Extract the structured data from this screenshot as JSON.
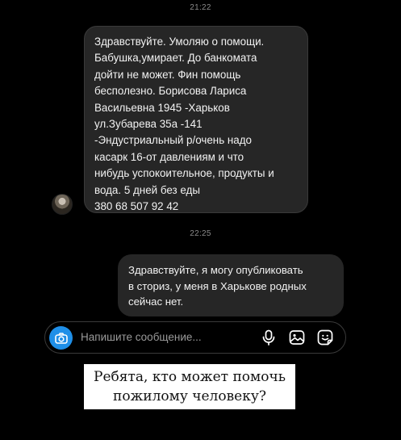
{
  "timestamps": [
    "21:22",
    "22:25"
  ],
  "incoming_message": {
    "lines": [
      "Здравствуйте. Умоляю о помощи.",
      "Бабушка,умирает. До банкомата",
      "дойти не может. Фин помощь",
      "бесполезно. Борисова Лариса",
      "Васильевна 1945 -Харьков",
      "ул.Зубарева 35а -141",
      "-Эндустриальный р/очень надо",
      "касарк 16-от давлениям и что",
      "нибудь успокоительное, продукты и",
      "вода. 5 дней без еды",
      "380 68 507 92 42"
    ]
  },
  "outgoing_message": {
    "lines": [
      "Здравствуйте, я могу опубликовать",
      "в сториз, у меня в Харькове родных",
      "сейчас нет."
    ]
  },
  "composer": {
    "placeholder": "Напишите сообщение...",
    "icons": [
      "camera-icon",
      "microphone-icon",
      "gallery-icon",
      "sticker-icon"
    ],
    "camera_color": "#1f8fe8"
  },
  "banner": {
    "lines": [
      "Ребята, кто может помочь",
      "пожилому человеку?"
    ]
  }
}
